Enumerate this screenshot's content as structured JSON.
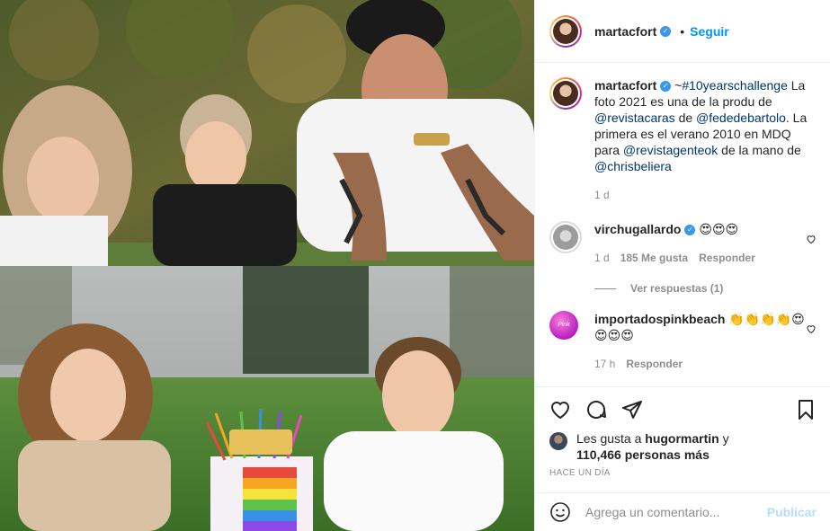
{
  "post": {
    "author": "martacfort",
    "follow_label": "Seguir",
    "separator": "•",
    "caption": {
      "prefix": "~",
      "hashtag": "#10yearschallenge",
      "text1": " La foto 2021 es una de la produ de ",
      "mention1": "@revistacaras",
      "text2": " de ",
      "mention2": "@fededebartolo",
      "text3": ". La primera es el verano 2010 en MDQ para ",
      "mention3": "@revistagenteok",
      "text4": " de la mano de ",
      "mention4": "@chrisbeliera"
    },
    "caption_time": "1 d"
  },
  "comments": [
    {
      "username": "virchugallardo",
      "text": "😍😍😍",
      "time": "1 d",
      "likes": "185 Me gusta",
      "reply_label": "Responder",
      "view_replies": "Ver respuestas (1)"
    },
    {
      "username": "importadospinkbeach",
      "avatar_text": "Pink Beach",
      "text": "👏👏👏👏😍😍😍😍",
      "time": "17 h",
      "reply_label": "Responder"
    }
  ],
  "likes": {
    "prefix": "Les gusta a ",
    "user": "hugormartin",
    "middle": " y ",
    "count": "110,466 personas más"
  },
  "post_time": "HACE UN DÍA",
  "add_comment": {
    "placeholder": "Agrega un comentario...",
    "publish_label": "Publicar"
  },
  "colors": {
    "link": "#00376b",
    "follow": "#0095f6",
    "publish_disabled": "#b2dffc",
    "muted": "#8e8e8e"
  }
}
